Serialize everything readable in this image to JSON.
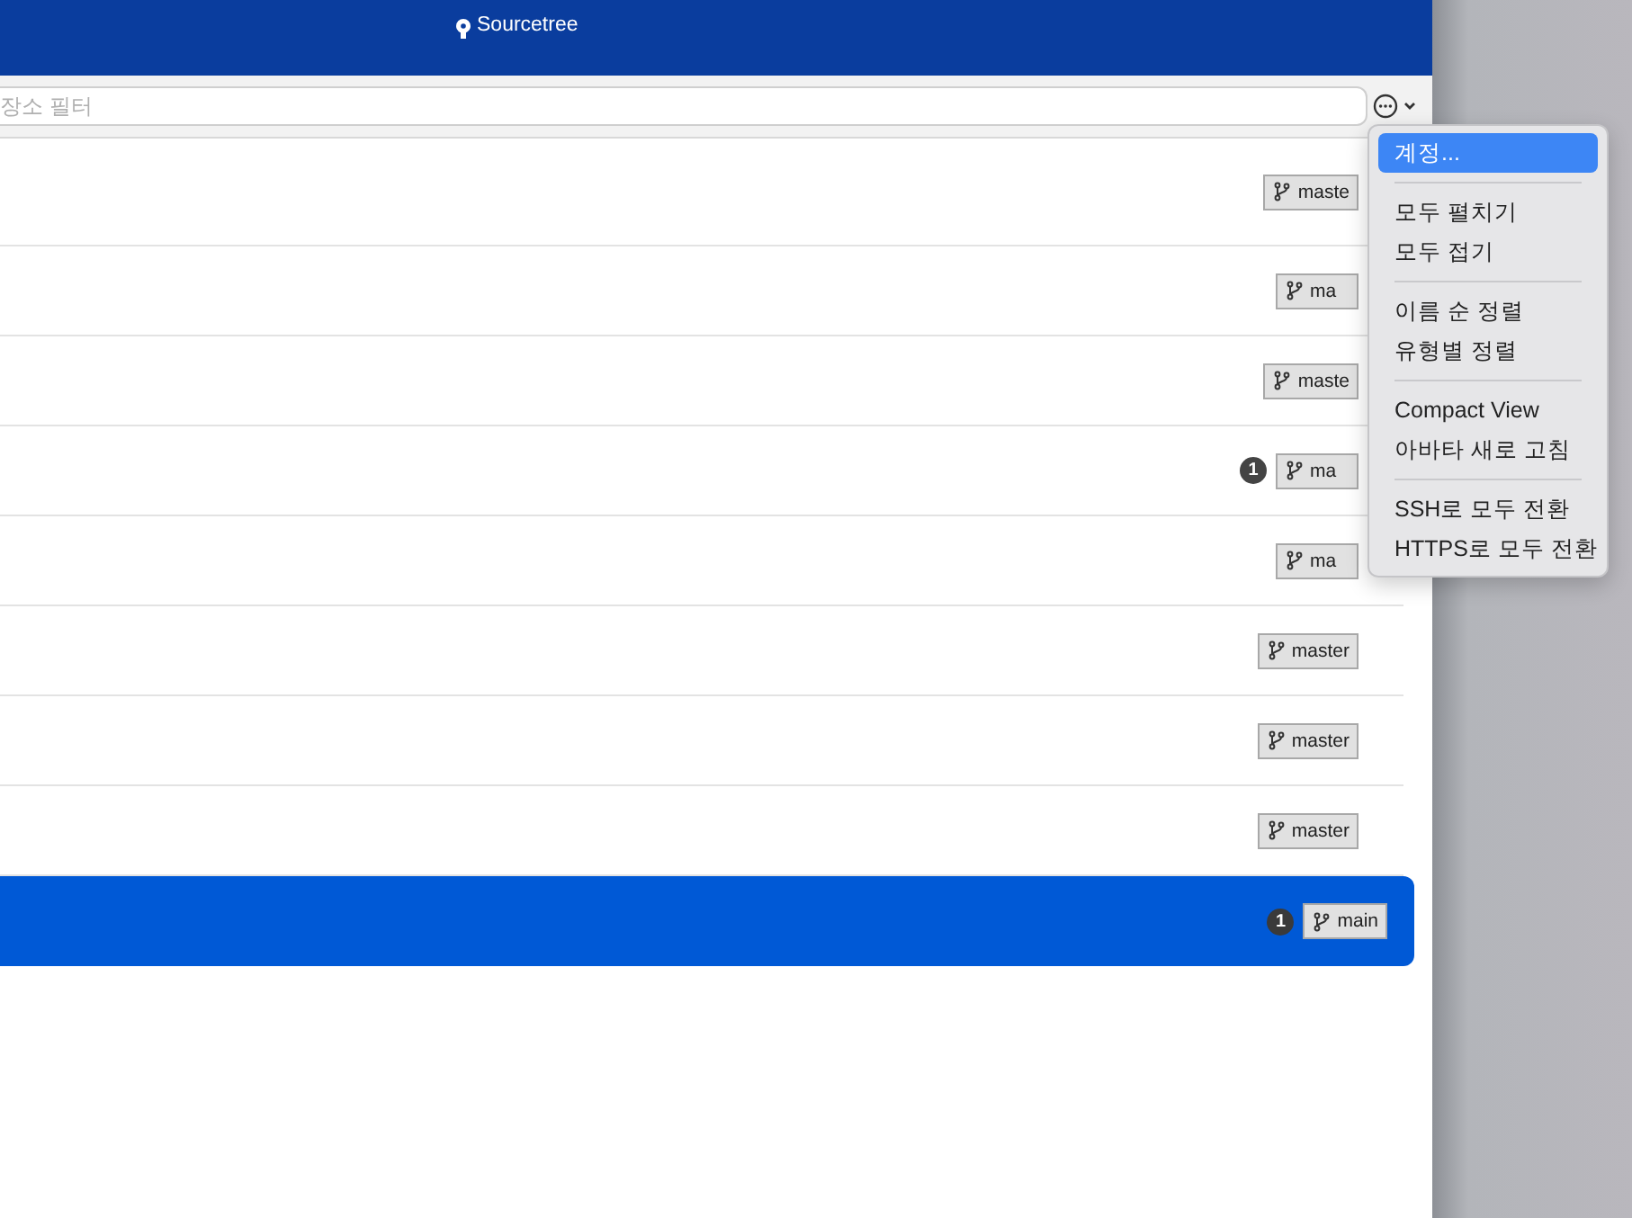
{
  "window": {
    "title": "Sourcetree"
  },
  "filter": {
    "placeholder": "장소 필터"
  },
  "repos": [
    {
      "branch": "maste",
      "selected": false
    },
    {
      "branch": "ma",
      "selected": false
    },
    {
      "branch": "maste",
      "selected": false
    },
    {
      "branch": "ma",
      "badge": "1",
      "selected": false
    },
    {
      "branch": "ma",
      "selected": false
    },
    {
      "branch": "master",
      "selected": false
    },
    {
      "branch": "master",
      "selected": false
    },
    {
      "branch": "master",
      "selected": false
    },
    {
      "branch": "main",
      "badge": "1",
      "selected": true
    }
  ],
  "menu": {
    "items": [
      {
        "kind": "item",
        "label": "계정...",
        "selected": true
      },
      {
        "kind": "separator"
      },
      {
        "kind": "item",
        "label": "모두 펼치기",
        "selected": false
      },
      {
        "kind": "item",
        "label": "모두 접기",
        "selected": false
      },
      {
        "kind": "separator"
      },
      {
        "kind": "item",
        "label": "이름 순 정렬",
        "selected": false
      },
      {
        "kind": "item",
        "label": "유형별 정렬",
        "selected": false
      },
      {
        "kind": "separator"
      },
      {
        "kind": "item",
        "label": "Compact View",
        "selected": false
      },
      {
        "kind": "item",
        "label": "아바타 새로 고침",
        "selected": false
      },
      {
        "kind": "separator"
      },
      {
        "kind": "item",
        "label": "SSH로 모두 전환",
        "selected": false
      },
      {
        "kind": "item",
        "label": "HTTPS로 모두 전환",
        "selected": false
      }
    ]
  }
}
